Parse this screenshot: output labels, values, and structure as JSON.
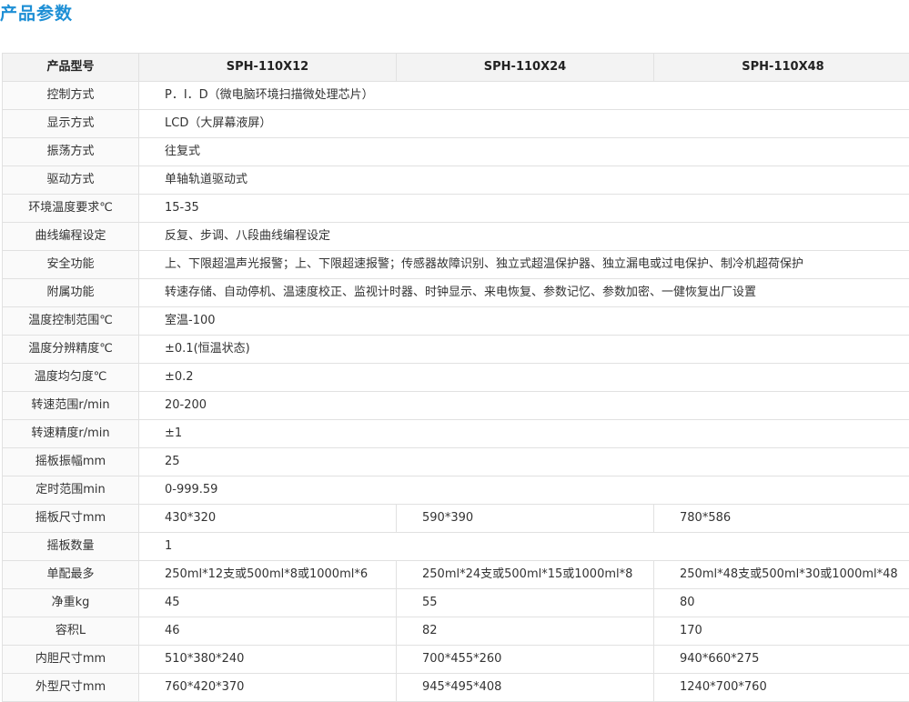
{
  "title": "产品参数",
  "header": {
    "label": "产品型号",
    "models": [
      "SPH-110X12",
      "SPH-110X24",
      "SPH-110X48"
    ]
  },
  "rows": [
    {
      "label": "控制方式",
      "value": "P．I．D（微电脑环境扫描微处理芯片）"
    },
    {
      "label": "显示方式",
      "value": "LCD（大屏幕液屏）"
    },
    {
      "label": "振荡方式",
      "value": "往复式"
    },
    {
      "label": "驱动方式",
      "value": "单轴轨道驱动式"
    },
    {
      "label": "环境温度要求℃",
      "value": "15-35"
    },
    {
      "label": "曲线编程设定",
      "value": "反复、步调、八段曲线编程设定"
    },
    {
      "label": "安全功能",
      "value": "上、下限超温声光报警；上、下限超速报警；传感器故障识别、独立式超温保护器、独立漏电或过电保护、制冷机超荷保护"
    },
    {
      "label": "附属功能",
      "value": "转速存储、自动停机、温速度校正、监视计时器、时钟显示、来电恢复、参数记忆、参数加密、一健恢复出厂设置"
    },
    {
      "label": "温度控制范围℃",
      "value": "室温-100"
    },
    {
      "label": "温度分辨精度℃",
      "value": "±0.1(恒温状态)"
    },
    {
      "label": "温度均匀度℃",
      "value": "±0.2"
    },
    {
      "label": "转速范围r/min",
      "value": "20-200"
    },
    {
      "label": "转速精度r/min",
      "value": "±1"
    },
    {
      "label": "摇板振幅mm",
      "value": "25"
    },
    {
      "label": "定时范围min",
      "value": "0-999.59"
    }
  ],
  "rows_split": [
    {
      "label": "摇板尺寸mm",
      "values": [
        "430*320",
        "590*390",
        "780*586"
      ]
    },
    {
      "label": "摇板数量",
      "value": "1"
    },
    {
      "label": "单配最多",
      "values": [
        "250ml*12支或500ml*8或1000ml*6",
        "250ml*24支或500ml*15或1000ml*8",
        "250ml*48支或500ml*30或1000ml*48"
      ]
    },
    {
      "label": "净重kg",
      "values": [
        "45",
        "55",
        "80"
      ]
    },
    {
      "label": "容积L",
      "values": [
        "46",
        "82",
        "170"
      ]
    },
    {
      "label": "内胆尺寸mm",
      "values": [
        "510*380*240",
        "700*455*260",
        "940*660*275"
      ]
    },
    {
      "label": "外型尺寸mm",
      "values": [
        "760*420*370",
        "945*495*408",
        "1240*700*760"
      ]
    }
  ]
}
